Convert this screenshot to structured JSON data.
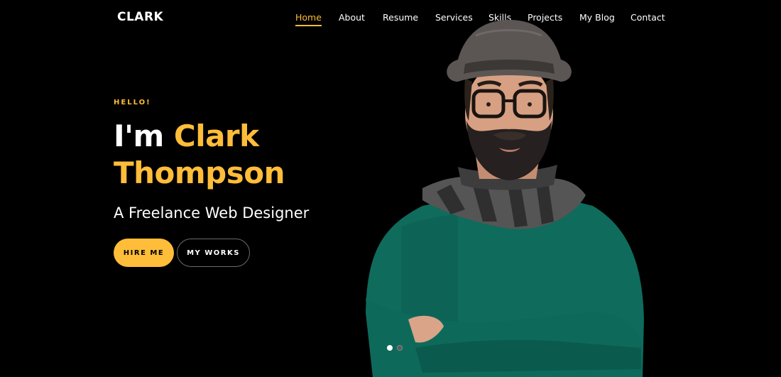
{
  "header": {
    "logo": "CLARK",
    "nav": [
      {
        "label": "Home",
        "active": true
      },
      {
        "label": "About",
        "active": false
      },
      {
        "label": "Resume",
        "active": false
      },
      {
        "label": "Services",
        "active": false
      },
      {
        "label": "Skills",
        "active": false
      },
      {
        "label": "Projects",
        "active": false
      },
      {
        "label": "My Blog",
        "active": false
      },
      {
        "label": "Contact",
        "active": false
      }
    ]
  },
  "hero": {
    "greeting": "HELLO!",
    "intro": "I'm",
    "first_name": "Clark",
    "last_name": "Thompson",
    "subtitle": "A Freelance Web Designer",
    "hire_button": "HIRE ME",
    "works_button": "MY WORKS",
    "photo_icon": "portrait-photo",
    "slides": {
      "count": 2,
      "active_index": 0
    }
  },
  "colors": {
    "background": "#000000",
    "accent": "#ffbd39",
    "text": "#ffffff"
  }
}
